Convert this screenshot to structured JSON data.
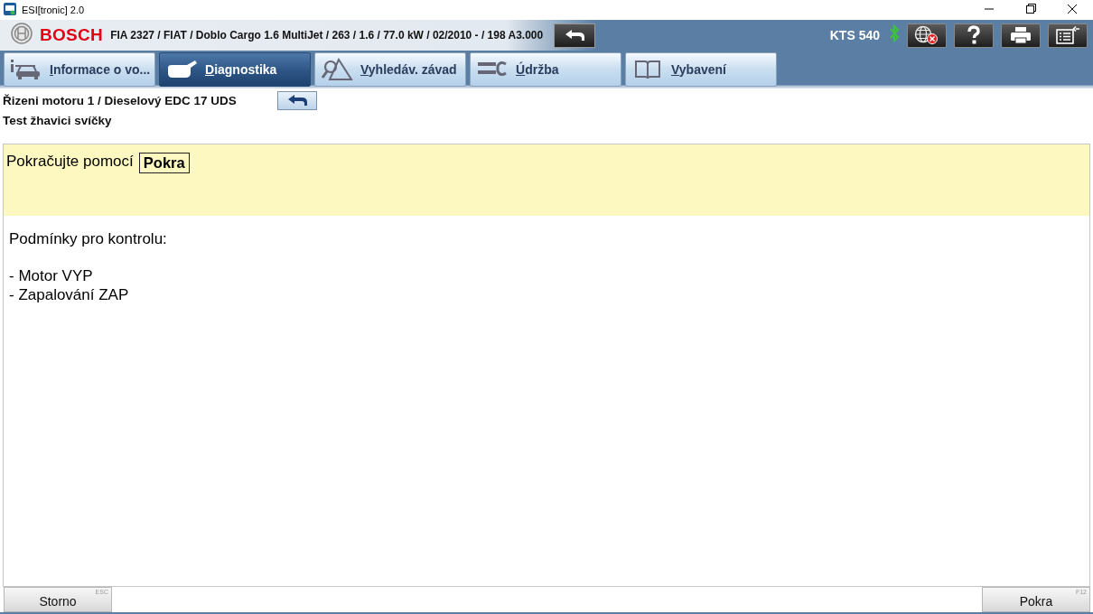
{
  "window": {
    "title": "ESI[tronic] 2.0"
  },
  "header": {
    "logo": "BOSCH",
    "vehicle": "FIA 2327 / FIAT / Doblo Cargo 1.6 MultiJet / 263 / 1.6 / 77.0 kW / 02/2010 - / 198 A3.000",
    "device": "KTS 540"
  },
  "tabs": [
    {
      "label": "Informace o vo...",
      "kind": "vehicle",
      "selected": false
    },
    {
      "label": "Diagnostika",
      "kind": "diagnosis",
      "selected": true
    },
    {
      "label": "Vyhledáv. závad",
      "kind": "search",
      "selected": false
    },
    {
      "label": "Údržba",
      "kind": "service",
      "selected": false
    },
    {
      "label": "Vybavení",
      "kind": "book",
      "selected": false
    }
  ],
  "breadcrumb": {
    "path": "Řizeni motoru 1 / Dieselový EDC 17 UDS",
    "test": "Test žhavici svíčky"
  },
  "instruction": {
    "text": "Pokračujte pomocí",
    "key": "Pokra"
  },
  "conditions": {
    "title": "Podmínky pro kontrolu:",
    "items": [
      "- Motor VYP",
      "- Zapalování ZAP"
    ]
  },
  "buttons": [
    {
      "label": "Storno",
      "shortcut": "ESC"
    },
    {
      "label": "Pokra",
      "shortcut": "F12"
    }
  ]
}
